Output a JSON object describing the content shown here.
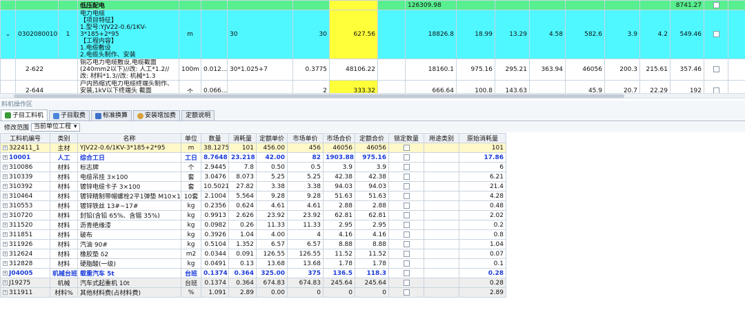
{
  "upper": {
    "top_row": {
      "name": "低压配电",
      "fee": "126309.98",
      "tail": "8741.27"
    },
    "main_row": {
      "code": "030208001001",
      "seq": "1",
      "name_lines": [
        "电力电缆",
        "【项目特征】",
        "1.型号:YJV22-0.6/1KV-3*185+2*95",
        "【工程内容】",
        "1.电缆敷设",
        "2.电缆头制作、安装"
      ],
      "unit": "m",
      "qty_expr": "30",
      "qty": "30",
      "price": "627.56",
      "total": "18826.8",
      "c1": "18.99",
      "c2": "13.29",
      "c3": "4.58",
      "c4": "582.6",
      "c5": "3.9",
      "c6": "4.2",
      "c7": "549.46"
    },
    "sub_rows": [
      {
        "code": "2-622",
        "name": "铜芯电力电缆敷设,电缆截面(240mm2以下)//改: 人工*1.2//改: 材料*1.3//改: 机械*1.3",
        "unit": "100m",
        "content": "0.012...",
        "qty_expr": "30*1.025+7",
        "qty": "0.3775",
        "price": "48106.22",
        "total": "18160.1",
        "c1": "975.16",
        "c2": "295.21",
        "c3": "363.94",
        "c4": "46056",
        "c5": "200.3",
        "c6": "215.61",
        "c7": "357.46"
      },
      {
        "code": "2-644",
        "name": "户内热缩式电力电缆终端头制作、安装,1kV以下终端头 截面(240mm2以下)//改: 人工*1.2",
        "unit": "个",
        "content": "0.066...",
        "qty_expr": "",
        "qty": "2",
        "price": "333.32",
        "total": "666.64",
        "c1": "100.8",
        "c2": "143.63",
        "c3": "",
        "c4": "45.9",
        "c5": "20.7",
        "c6": "22.29",
        "c7": "192"
      }
    ]
  },
  "panel": {
    "title": "料机操作区",
    "tabs": [
      "子目工料机",
      "子目取费",
      "标准换算",
      "安装增加费",
      "定额说明"
    ],
    "scope_label": "修改范围",
    "scope_value": "当前单位工程"
  },
  "columns": [
    "工料机编号",
    "类别",
    "名称",
    "单位",
    "数量",
    "消耗量",
    "定额单价",
    "市场单价",
    "市场合价",
    "定额合价",
    "锁定数量",
    "用途类别",
    "原始消耗量"
  ],
  "rows": [
    {
      "code": "322411_1",
      "type": "主材",
      "name": "YJV22-0.6/1KV-3*185+2*95",
      "unit": "m",
      "qty": "38.1275",
      "cons": "101",
      "dprice": "456.00",
      "mprice": "456",
      "mtotal": "46056",
      "dtotal": "46056",
      "orig": "101",
      "style": "main"
    },
    {
      "code": "10001",
      "type": "人工",
      "name": "综合工日",
      "unit": "工日",
      "qty": "8.7648",
      "cons": "23.218",
      "dprice": "42.00",
      "mprice": "82",
      "mtotal": "1903.88",
      "dtotal": "975.16",
      "orig": "17.86",
      "style": "labor"
    },
    {
      "code": "310086",
      "type": "材料",
      "name": "标志牌",
      "unit": "个",
      "qty": "2.9445",
      "cons": "7.8",
      "dprice": "0.50",
      "mprice": "0.5",
      "mtotal": "3.9",
      "dtotal": "3.9",
      "orig": "6",
      "style": ""
    },
    {
      "code": "310339",
      "type": "材料",
      "name": "电缆吊挂 3×100",
      "unit": "套",
      "qty": "3.0476",
      "cons": "8.073",
      "dprice": "5.25",
      "mprice": "5.25",
      "mtotal": "42.38",
      "dtotal": "42.38",
      "orig": "6.21",
      "style": ""
    },
    {
      "code": "310392",
      "type": "材料",
      "name": "镀锌电缆卡子 3×100",
      "unit": "套",
      "qty": "10.5021",
      "cons": "27.82",
      "dprice": "3.38",
      "mprice": "3.38",
      "mtotal": "94.03",
      "dtotal": "94.03",
      "orig": "21.4",
      "style": ""
    },
    {
      "code": "310464",
      "type": "材料",
      "name": "镀锌精制带帽螺栓2平1弹垫 M10×10...",
      "unit": "10套",
      "qty": "2.1004",
      "cons": "5.564",
      "dprice": "9.28",
      "mprice": "9.28",
      "mtotal": "51.63",
      "dtotal": "51.63",
      "orig": "4.28",
      "style": ""
    },
    {
      "code": "310553",
      "type": "材料",
      "name": "镀锌铁丝 13#~17#",
      "unit": "kg",
      "qty": "0.2356",
      "cons": "0.624",
      "dprice": "4.61",
      "mprice": "4.61",
      "mtotal": "2.88",
      "dtotal": "2.88",
      "orig": "0.48",
      "style": ""
    },
    {
      "code": "310720",
      "type": "材料",
      "name": "封铅(含铅 65%、含锡 35%)",
      "unit": "kg",
      "qty": "0.9913",
      "cons": "2.626",
      "dprice": "23.92",
      "mprice": "23.92",
      "mtotal": "62.81",
      "dtotal": "62.81",
      "orig": "2.02",
      "style": ""
    },
    {
      "code": "311520",
      "type": "材料",
      "name": "沥青绝缘漆",
      "unit": "kg",
      "qty": "0.0982",
      "cons": "0.26",
      "dprice": "11.33",
      "mprice": "11.33",
      "mtotal": "2.95",
      "dtotal": "2.95",
      "orig": "0.2",
      "style": ""
    },
    {
      "code": "311851",
      "type": "材料",
      "name": "破布",
      "unit": "kg",
      "qty": "0.3926",
      "cons": "1.04",
      "dprice": "4.00",
      "mprice": "4",
      "mtotal": "4.16",
      "dtotal": "4.16",
      "orig": "0.8",
      "style": ""
    },
    {
      "code": "311926",
      "type": "材料",
      "name": "汽油 90#",
      "unit": "kg",
      "qty": "0.5104",
      "cons": "1.352",
      "dprice": "6.57",
      "mprice": "6.57",
      "mtotal": "8.88",
      "dtotal": "8.88",
      "orig": "1.04",
      "style": "hl"
    },
    {
      "code": "312624",
      "type": "材料",
      "name": "橡胶垫 δ2",
      "unit": "m2",
      "qty": "0.0344",
      "cons": "0.091",
      "dprice": "126.55",
      "mprice": "126.55",
      "mtotal": "11.52",
      "dtotal": "11.52",
      "orig": "0.07",
      "style": ""
    },
    {
      "code": "312828",
      "type": "材料",
      "name": "硬脂酸(一级)",
      "unit": "kg",
      "qty": "0.0491",
      "cons": "0.13",
      "dprice": "13.68",
      "mprice": "13.68",
      "mtotal": "1.78",
      "dtotal": "1.78",
      "orig": "0.1",
      "style": ""
    },
    {
      "code": "J04005",
      "type": "机械台班",
      "name": "载重汽车 5t",
      "unit": "台班",
      "qty": "0.1374",
      "cons": "0.364",
      "dprice": "325.00",
      "mprice": "375",
      "mtotal": "136.5",
      "dtotal": "118.3",
      "orig": "0.28",
      "style": "mach"
    },
    {
      "code": "J19275",
      "type": "机械",
      "name": "汽车式起重机 10t",
      "unit": "台班",
      "qty": "0.1374",
      "cons": "0.364",
      "dprice": "674.83",
      "mprice": "674.83",
      "mtotal": "245.64",
      "dtotal": "245.64",
      "orig": "0.28",
      "style": "gray"
    },
    {
      "code": "311911",
      "type": "材料%",
      "name": "其他材料费(占材料费)",
      "unit": "%",
      "qty": "1.091",
      "cons": "2.89",
      "dprice": "0.00",
      "mprice": "0",
      "mtotal": "0",
      "dtotal": "0",
      "orig": "2.89",
      "style": "gray"
    }
  ]
}
